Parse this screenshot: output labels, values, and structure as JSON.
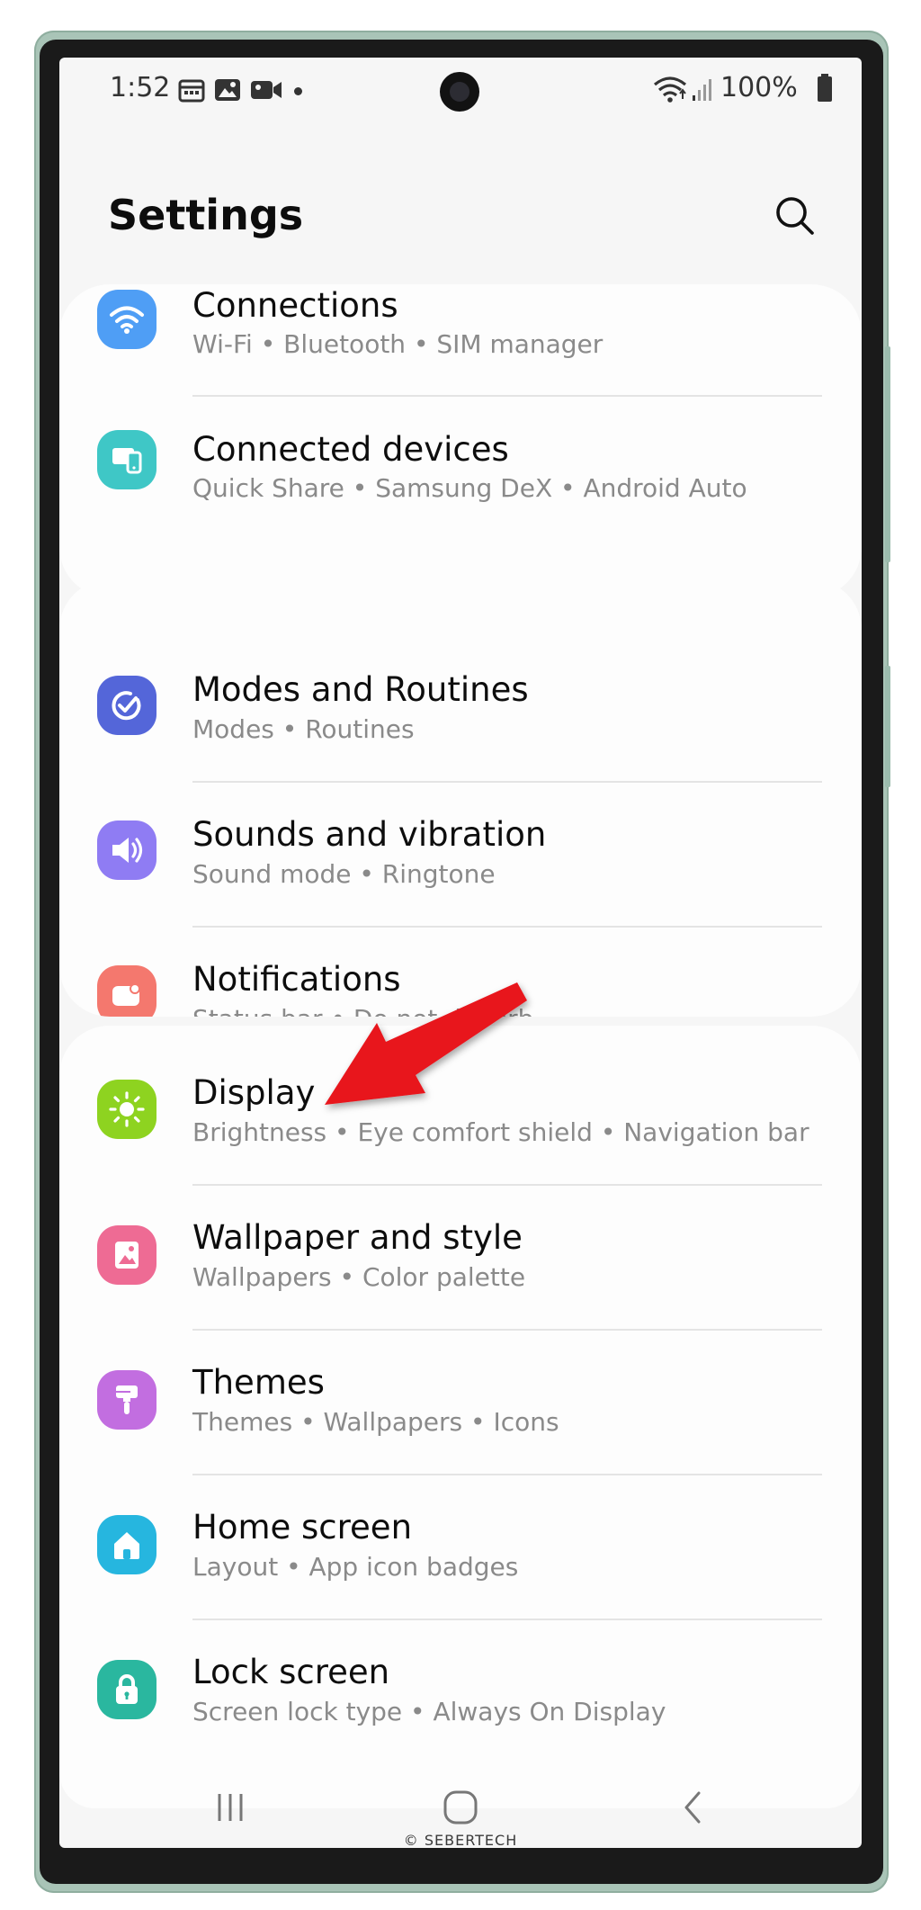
{
  "status_bar": {
    "time": "1:52",
    "battery": "100%",
    "icons": [
      "calendar-icon",
      "image-icon",
      "video-icon",
      "dot-icon",
      "wifi-icon",
      "signal-icon",
      "battery-icon"
    ]
  },
  "header": {
    "title": "Settings",
    "search_icon": "search-icon"
  },
  "groups": [
    {
      "items": [
        {
          "title": "Connections",
          "subtitle": "Wi-Fi  •  Bluetooth  •  SIM manager",
          "icon": "wifi-icon",
          "color": "#4f9ef5"
        },
        {
          "title": "Connected devices",
          "subtitle": "Quick Share  •  Samsung DeX  •  Android Auto",
          "icon": "devices-icon",
          "color": "#3fc7c6"
        }
      ]
    },
    {
      "items": [
        {
          "title": "Modes and Routines",
          "subtitle": "Modes  •  Routines",
          "icon": "check-circle-icon",
          "color": "#5466d9"
        },
        {
          "title": "Sounds and vibration",
          "subtitle": "Sound mode  •  Ringtone",
          "icon": "speaker-icon",
          "color": "#8f7cf3"
        },
        {
          "title": "Notifications",
          "subtitle": "Status bar  •  Do not disturb",
          "icon": "notification-icon",
          "color": "#f4786e"
        }
      ]
    },
    {
      "items": [
        {
          "title": "Display",
          "subtitle": "Brightness  •  Eye comfort shield  •  Navigation bar",
          "icon": "sun-icon",
          "color": "#8ed320"
        },
        {
          "title": "Wallpaper and style",
          "subtitle": "Wallpapers  •  Color palette",
          "icon": "wallpaper-icon",
          "color": "#ee6b94"
        },
        {
          "title": "Themes",
          "subtitle": "Themes  •  Wallpapers  •  Icons",
          "icon": "paintbrush-icon",
          "color": "#c26ee0"
        },
        {
          "title": "Home screen",
          "subtitle": "Layout  •  App icon badges",
          "icon": "home-icon",
          "color": "#26b6df"
        },
        {
          "title": "Lock screen",
          "subtitle": "Screen lock type  •  Always On Display",
          "icon": "lock-icon",
          "color": "#2ab79f"
        }
      ]
    }
  ],
  "nav_bar": {
    "recents_icon": "recents-icon",
    "home_icon": "home-button-icon",
    "back_icon": "back-icon"
  },
  "watermark": "© SEBERTECH",
  "annotation": {
    "arrow_color": "#e8121b",
    "arrow_icon": "red-arrow-icon",
    "points_to": "Display"
  }
}
